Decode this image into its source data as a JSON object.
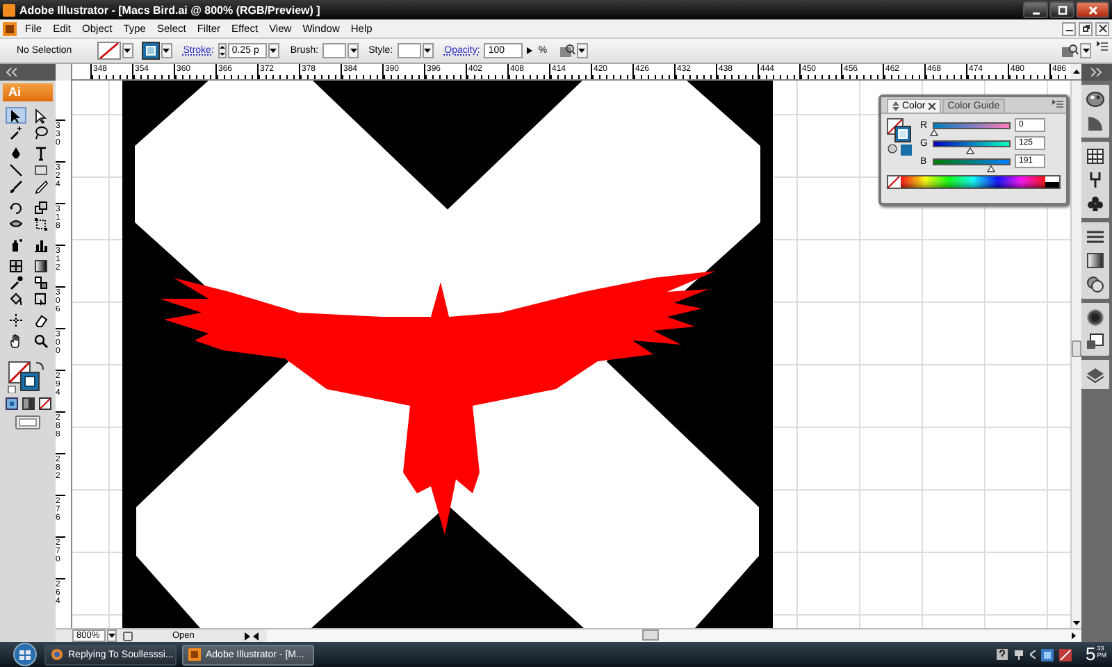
{
  "window": {
    "title": "Adobe Illustrator - [Macs Bird.ai @ 800% (RGB/Preview) ]"
  },
  "menu": [
    "File",
    "Edit",
    "Object",
    "Type",
    "Select",
    "Filter",
    "Effect",
    "View",
    "Window",
    "Help"
  ],
  "control_bar": {
    "selection": "No Selection",
    "stroke_label": "Stroke:",
    "stroke_weight": "0.25 p",
    "brush_label": "Brush:",
    "style_label": "Style:",
    "opacity_label": "Opacity:",
    "opacity": "100",
    "opacity_unit": "%"
  },
  "ruler_h": [
    "348",
    "354",
    "360",
    "366",
    "372",
    "378",
    "384",
    "390",
    "396",
    "402",
    "408",
    "414",
    "420",
    "426",
    "432",
    "438",
    "444",
    "450",
    "456",
    "462",
    "468",
    "474",
    "480",
    "486"
  ],
  "ruler_v": [
    "330",
    "324",
    "318",
    "312",
    "306",
    "300",
    "294",
    "288",
    "282",
    "276",
    "270",
    "264"
  ],
  "toolbox": {
    "logo": "Ai",
    "tools": [
      {
        "selected": true
      },
      {
        "selected": false
      },
      {
        "selected": false
      },
      {
        "selected": false
      },
      {
        "selected": false
      },
      {
        "selected": false
      },
      {
        "selected": false
      },
      {
        "selected": false
      },
      {
        "selected": false
      },
      {
        "selected": false
      },
      {
        "selected": false
      },
      {
        "selected": false
      },
      {
        "selected": false
      },
      {
        "selected": false
      },
      {
        "selected": false
      },
      {
        "selected": false
      },
      {
        "selected": false
      },
      {
        "selected": false
      },
      {
        "selected": false
      },
      {
        "selected": false
      },
      {
        "selected": false
      },
      {
        "selected": false
      },
      {
        "selected": false
      },
      {
        "selected": false
      },
      {
        "selected": false
      },
      {
        "selected": false
      }
    ]
  },
  "color_panel": {
    "tabs": [
      {
        "label": "Color",
        "selected": true
      },
      {
        "label": "Color Guide",
        "selected": false
      }
    ],
    "channels": [
      {
        "label": "R",
        "level": 0,
        "value": "0"
      },
      {
        "label": "G",
        "level": 0.49,
        "value": "125"
      },
      {
        "label": "B",
        "level": 0.75,
        "value": "191"
      }
    ]
  },
  "status_bar": {
    "zoom": "800%",
    "info": "Open"
  },
  "taskbar": {
    "tasks": [
      {
        "label": "Replying To Soullesssi...",
        "selected": false
      },
      {
        "label": "Adobe Illustrator - [M...",
        "selected": true
      }
    ],
    "clock_hour": "5",
    "clock_minutes": "33",
    "clock_period": "PM"
  }
}
